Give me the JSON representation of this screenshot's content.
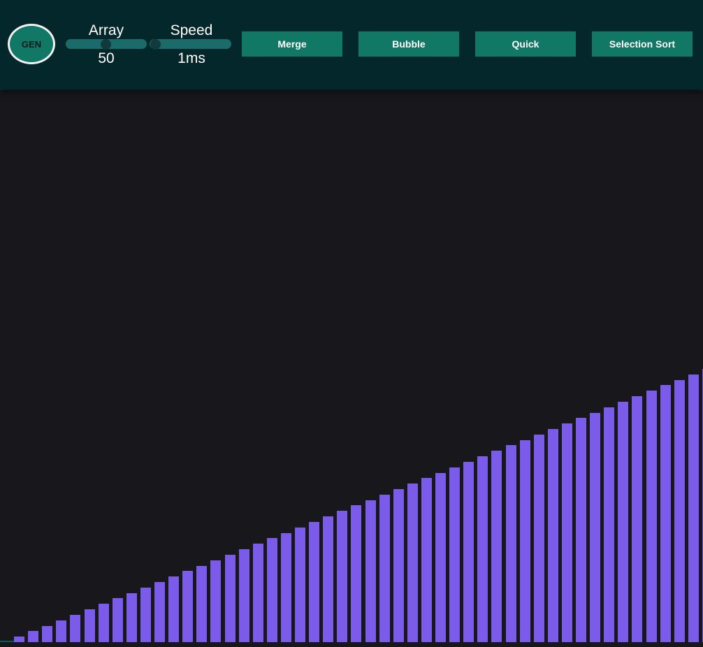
{
  "header": {
    "gen_label": "GEN",
    "array_label": "Array",
    "array_value": "50",
    "speed_label": "Speed",
    "speed_value": "1ms",
    "array_slider_level": 0.5,
    "speed_slider_level": 0.0,
    "buttons": {
      "merge": "Merge",
      "bubble": "Bubble",
      "quick": "Quick",
      "selection": "Selection Sort"
    }
  },
  "colors": {
    "header_bg": "#03272a",
    "button_bg": "#117865",
    "bar": "#7b5bea",
    "canvas_bg": "#18181c"
  },
  "bars": {
    "count": 50,
    "values": [
      1,
      2,
      3,
      4,
      5,
      6,
      7,
      8,
      9,
      10,
      11,
      12,
      13,
      14,
      15,
      16,
      17,
      18,
      19,
      20,
      21,
      22,
      23,
      24,
      25,
      26,
      27,
      28,
      29,
      30,
      31,
      32,
      33,
      34,
      35,
      36,
      37,
      38,
      39,
      40,
      41,
      42,
      43,
      44,
      45,
      46,
      47,
      48,
      49,
      50
    ]
  }
}
